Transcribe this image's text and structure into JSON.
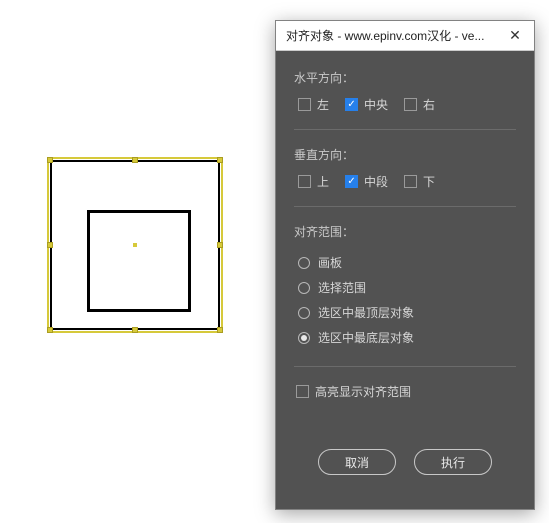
{
  "dialog": {
    "title": "对齐对象 - www.epinv.com汉化 - ve...",
    "horizontal": {
      "label": "水平方向：",
      "left": "左",
      "center": "中央",
      "right": "右",
      "checked": "center"
    },
    "vertical": {
      "label": "垂直方向：",
      "top": "上",
      "middle": "中段",
      "bottom": "下",
      "checked": "middle"
    },
    "scope": {
      "label": "对齐范围：",
      "options": {
        "artboard": "画板",
        "selection": "选择范围",
        "topmost": "选区中最顶层对象",
        "bottommost": "选区中最底层对象"
      },
      "selected": "bottommost"
    },
    "highlight": {
      "label": "高亮显示对齐范围",
      "checked": false
    },
    "buttons": {
      "cancel": "取消",
      "execute": "执行"
    }
  }
}
